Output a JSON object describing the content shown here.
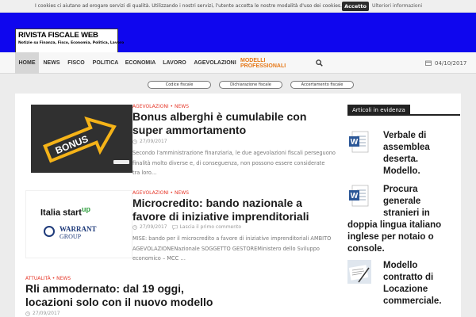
{
  "cookie": {
    "text": "I cookies ci aiutano ad erogare servizi di qualità. Utilizzando i nostri servizi, l'utente accetta le nostre modalità d'uso dei cookies.",
    "accept": "Accetto",
    "more": "Ulteriori informazioni"
  },
  "header": {
    "logo_title": "RIVISTA FISCALE WEB",
    "logo_subtitle": "Notizie su Finanza, Fisco, Economia, Politica, Lavoro",
    "color": "#0f06ee"
  },
  "nav": {
    "items": [
      {
        "label": "HOME"
      },
      {
        "label": "NEWS"
      },
      {
        "label": "FISCO"
      },
      {
        "label": "POLITICA"
      },
      {
        "label": "ECONOMIA"
      },
      {
        "label": "LAVORO"
      },
      {
        "label": "AGEVOLAZIONI"
      },
      {
        "label": "MODELLI PROFESSIONALI"
      }
    ],
    "date": "04/10/2017",
    "accent": "#e67817"
  },
  "tags": [
    {
      "label": "Codice fiscale"
    },
    {
      "label": "Dichiarazione fiscale"
    },
    {
      "label": "Accertamento fiscale"
    }
  ],
  "posts": [
    {
      "cat1": "AGEVOLAZIONI",
      "cat2": "NEWS",
      "title_line1": "Bonus alberghi è cumulabile con",
      "title_line2": "super ammortamento",
      "date": "27/09/2017",
      "comments": "",
      "excerpt_line1": "Secondo l'amministrazione finanziaria, le due agevolazioni fiscali perseguono",
      "excerpt_line2": "finalità molto diverse e, di conseguenza, non possono essere considerate",
      "excerpt_line3": "tra loro…",
      "thumb_text": "BONUS"
    },
    {
      "cat1": "AGEVOLAZIONI",
      "cat2": "NEWS",
      "title_line1": "Microcredito: bando nazionale a",
      "title_line2": "favore di iniziative imprenditoriali",
      "date": "27/09/2017",
      "comments": "Lascia il primo commento",
      "excerpt_line1": "MISE: bando per il microcredito a favore di iniziative imprenditoriali AMBITO",
      "excerpt_line2": "AGEVOLAZIONENazionale SOGGETTO GESTOREMinistero dello Sviluppo",
      "excerpt_line3": "economico – MCC  …",
      "thumb_text1": "Italia start",
      "thumb_text1_sup": "up",
      "thumb_text2": "WARRANT",
      "thumb_text3": "GROUP"
    },
    {
      "cat1": "ATTUALITÀ",
      "cat2": "NEWS",
      "title_line1": "Rli ammodernato: dal 19 oggi,",
      "title_line2": "locazioni solo con il nuovo modello",
      "date": "27/09/2017"
    }
  ],
  "sidebar": {
    "heading": "Articoli in evidenza",
    "items": [
      {
        "line1": "Verbale di",
        "line2": "assemblea",
        "line3": "deserta.",
        "line4": "Modello.",
        "icon": "word-document-icon"
      },
      {
        "line1": "Procura",
        "line2": "generale",
        "line3": "stranieri in",
        "line4": "doppia lingua italiano",
        "line5": "inglese per notaio o",
        "line6": "console.",
        "icon": "word-document-icon"
      },
      {
        "line1": "Modello",
        "line2": "contratto di",
        "line3": "Locazione",
        "line4": "commerciale.",
        "icon": "contract-photo-icon"
      }
    ]
  },
  "colors": {
    "category": "#e63a2c",
    "sidebar_head": "#222222"
  }
}
